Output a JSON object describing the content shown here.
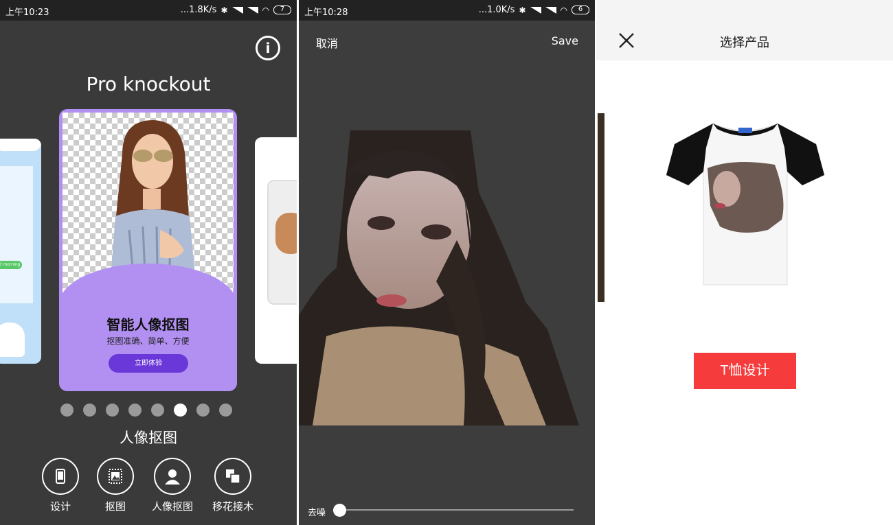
{
  "panel1": {
    "status": {
      "time": "上午10:23",
      "speed": "...1.8K/s",
      "battery": "7"
    },
    "title": "Pro knockout",
    "card": {
      "title": "智能人像抠图",
      "subtitle": "抠图准确、简单、方便",
      "button": "立即体验"
    },
    "left_card_chat": "od morning",
    "pager": {
      "count": 8,
      "active_index": 5
    },
    "section_label": "人像抠图",
    "tools": [
      {
        "label": "设计",
        "icon": "phone-icon"
      },
      {
        "label": "抠图",
        "icon": "image-icon"
      },
      {
        "label": "人像抠图",
        "icon": "person-icon"
      },
      {
        "label": "移花接木",
        "icon": "layers-icon"
      }
    ],
    "colors": {
      "background": "#3a3a3a",
      "card_purple": "#b290f2",
      "button_purple": "#6a37d8"
    }
  },
  "panel2": {
    "status": {
      "time": "上午10:28",
      "speed": "...1.0K/s",
      "battery": "6"
    },
    "cancel_label": "取消",
    "save_label": "Save",
    "denoise_label": "去噪",
    "denoise_value": 0
  },
  "panel3": {
    "title": "选择产品",
    "button_label": "T恤设计",
    "colors": {
      "button": "#f53b3b"
    }
  }
}
